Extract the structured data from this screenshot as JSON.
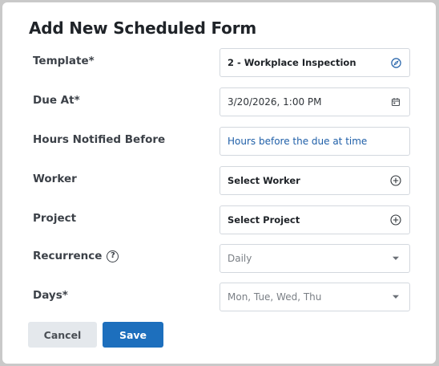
{
  "dialog": {
    "title": "Add New Scheduled Form"
  },
  "form": {
    "template": {
      "label": "Template*",
      "value": "2 - Workplace Inspection",
      "icon": "compass-icon"
    },
    "due_at": {
      "label": "Due At*",
      "value": "3/20/2026, 1:00 PM",
      "icon": "calendar-icon"
    },
    "hours_notified": {
      "label": "Hours Notified Before",
      "placeholder": "Hours before the due at time"
    },
    "worker": {
      "label": "Worker",
      "value": "Select Worker",
      "icon": "plus-circle-icon"
    },
    "project": {
      "label": "Project",
      "value": "Select Project",
      "icon": "plus-circle-icon"
    },
    "recurrence": {
      "label": "Recurrence",
      "value": "Daily",
      "help_icon": "question-circle-icon",
      "help_glyph": "?",
      "icon": "caret-down-icon"
    },
    "days": {
      "label": "Days*",
      "value": "Mon, Tue, Wed, Thu",
      "icon": "caret-down-icon"
    }
  },
  "actions": {
    "cancel_label": "Cancel",
    "save_label": "Save"
  },
  "colors": {
    "accent": "#1d6fbd",
    "link": "#1f5fa8",
    "cancel_bg": "#e4e8ec",
    "backdrop": "#c9c9c9"
  }
}
